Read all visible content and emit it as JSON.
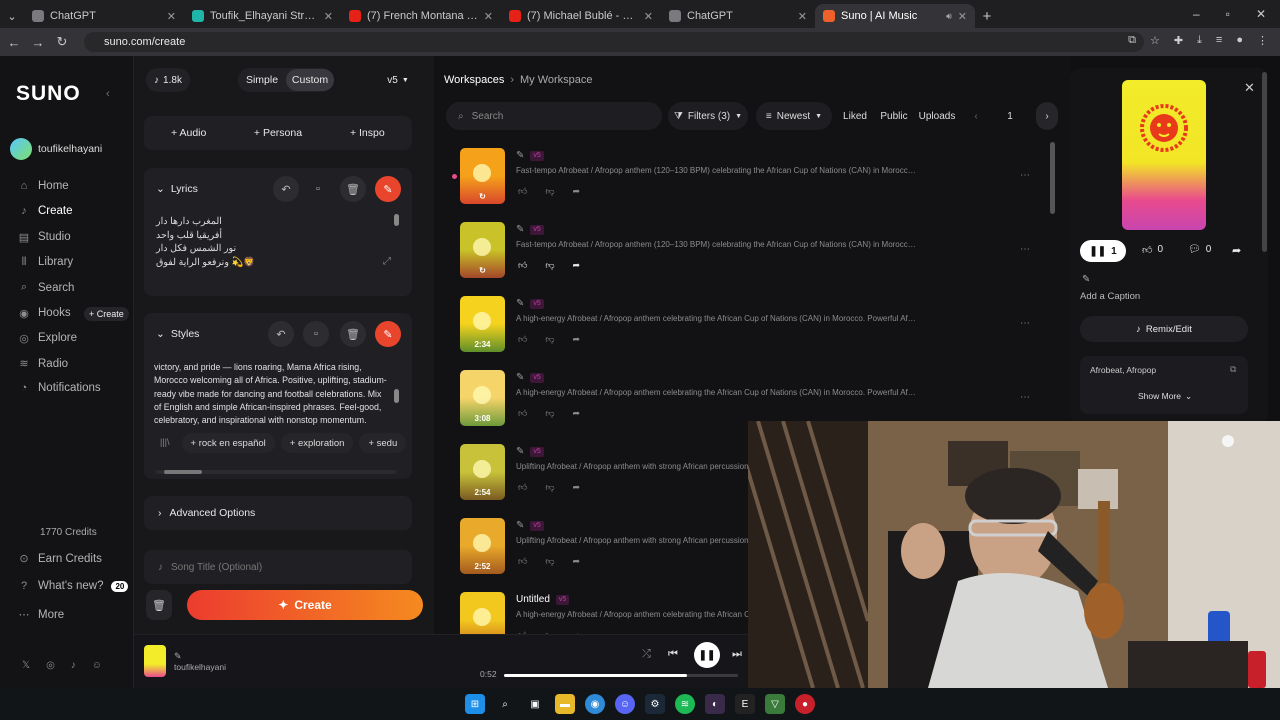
{
  "browser": {
    "tabs": [
      {
        "label": "ChatGPT",
        "color": "#7a7a7e"
      },
      {
        "label": "Toufik_Elhayani Stream - Watch",
        "color": "#1fb6aa"
      },
      {
        "label": "(7) French Montana & Akon & ...",
        "color": "#e62117"
      },
      {
        "label": "(7) Michael Bublé - Feeling Goo...",
        "color": "#e62117"
      },
      {
        "label": "ChatGPT",
        "color": "#7a7a7e"
      },
      {
        "label": "Suno | AI Music",
        "color": "#f0602a"
      }
    ],
    "url": "suno.com/create"
  },
  "sidebar": {
    "logo": "SUNO",
    "username": "toufikelhayani",
    "items": [
      {
        "label": "Home",
        "icon": "home-icon"
      },
      {
        "label": "Create",
        "icon": "create-icon"
      },
      {
        "label": "Studio",
        "icon": "studio-icon"
      },
      {
        "label": "Library",
        "icon": "library-icon"
      },
      {
        "label": "Search",
        "icon": "search-icon"
      },
      {
        "label": "Hooks",
        "icon": "hooks-icon"
      },
      {
        "label": "Explore",
        "icon": "explore-icon"
      },
      {
        "label": "Radio",
        "icon": "radio-icon"
      },
      {
        "label": "Notifications",
        "icon": "bell-icon"
      }
    ],
    "hooks_create": "+ Create",
    "credits": "1770 Credits",
    "earn": "Earn Credits",
    "whats_new": "What's new?",
    "whats_new_count": "20",
    "more": "More"
  },
  "panel": {
    "credits_pill": "1.8k",
    "mode_simple": "Simple",
    "mode_custom": "Custom",
    "version": "v5",
    "audio": "+ Audio",
    "persona": "+ Persona",
    "inspo": "+ Inspo",
    "lyrics_label": "Lyrics",
    "lyrics_lines": [
      "المغرب دارها دار",
      "أفريقيا قلب واحد",
      "نور الشمس فكل دار",
      "ونرفعو الراية لفوق 💫🦁"
    ],
    "styles_label": "Styles",
    "styles_text": "victory, and pride — lions roaring, Mama Africa rising, Morocco welcoming all of Africa. Positive, uplifting, stadium-ready vibe made for dancing and football celebrations. Mix of English and simple African-inspired phrases. Feel-good, celebratory, and inspirational with nonstop momentum.",
    "tags": [
      "+ rock en español",
      "+ exploration",
      "+ sedu"
    ],
    "advanced": "Advanced Options",
    "song_title_placeholder": "Song Title (Optional)",
    "create": "Create"
  },
  "library": {
    "crumb_root": "Workspaces",
    "crumb_current": "My Workspace",
    "search_placeholder": "Search",
    "filters": "Filters (3)",
    "sort": "Newest",
    "liked": "Liked",
    "public": "Public",
    "uploads": "Uploads",
    "page": "1",
    "songs": [
      {
        "title": "",
        "desc": "Fast-tempo Afrobeat / Afropop anthem (120–130 BPM) celebrating the African Cup of Nations (CAN) in Morocco, Hig...",
        "duration": "",
        "colors": [
          "#f5a21a",
          "#d8472b"
        ]
      },
      {
        "title": "",
        "desc": "Fast-tempo Afrobeat / Afropop anthem (120–130 BPM) celebrating the African Cup of Nations (CAN) in Morocco, Hig...",
        "duration": "",
        "colors": [
          "#c9c228",
          "#a3462a"
        ]
      },
      {
        "title": "",
        "desc": "A high-energy Afrobeat / Afropop anthem celebrating the African Cup of Nations (CAN) in Morocco. Powerful African...",
        "duration": "2:34",
        "colors": [
          "#f4d21e",
          "#5f8e2a"
        ]
      },
      {
        "title": "",
        "desc": "A high-energy Afrobeat / Afropop anthem celebrating the African Cup of Nations (CAN) in Morocco. Powerful African...",
        "duration": "3:08",
        "colors": [
          "#f5d46a",
          "#6e9a3a"
        ]
      },
      {
        "title": "",
        "desc": "Uplifting Afrobeat / Afropop anthem with strong African percussion and...",
        "duration": "2:54",
        "colors": [
          "#c7c23a",
          "#7a5a22"
        ]
      },
      {
        "title": "",
        "desc": "Uplifting Afrobeat / Afropop anthem with strong African percussion and...",
        "duration": "2:52",
        "colors": [
          "#e9a92b",
          "#a35a1e"
        ]
      },
      {
        "title": "Untitled",
        "desc": "A high-energy Afrobeat / Afropop anthem celebrating the African Cup...",
        "duration": "",
        "colors": [
          "#f2c81e",
          "#c66b1d"
        ]
      }
    ]
  },
  "right": {
    "plays": "1",
    "likes": "0",
    "comments": "0",
    "caption": "Add a Caption",
    "remix": "Remix/Edit",
    "genre": "Afrobeat, Afropop",
    "show_more": "Show More"
  },
  "player": {
    "artist": "toufikelhayani",
    "time": "0:52",
    "progress": 0.78
  },
  "accent": "#e8452c"
}
